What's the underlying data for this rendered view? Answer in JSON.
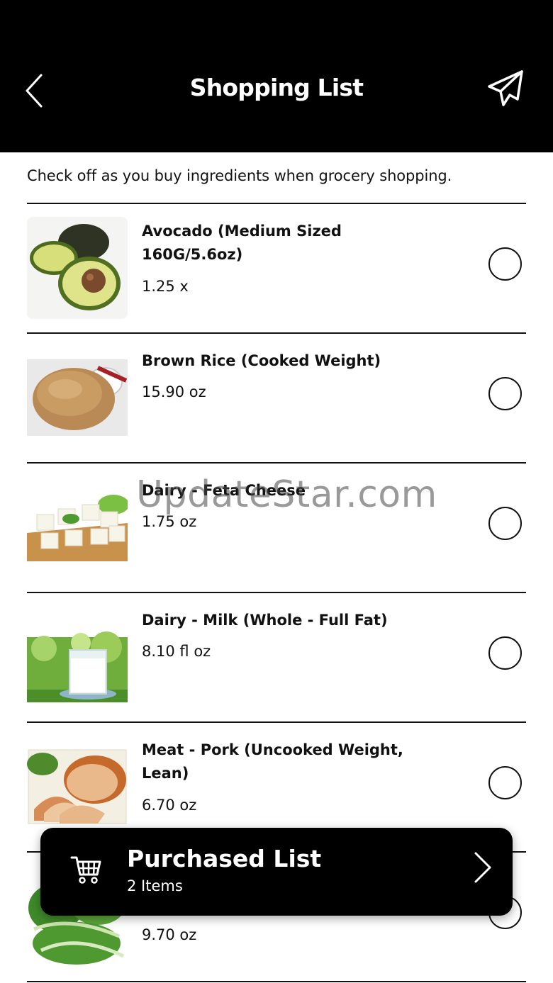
{
  "header": {
    "title": "Shopping List",
    "back_icon": "chevron-left-icon",
    "send_icon": "paper-plane-icon"
  },
  "subtitle": "Check off as you buy ingredients when grocery shopping.",
  "items": [
    {
      "name": "Avocado (Medium Sized 160G/5.6oz)",
      "qty": "1.25 x",
      "checked": false,
      "image": "avocado"
    },
    {
      "name": "Brown Rice (Cooked Weight)",
      "qty": "15.90 oz",
      "checked": false,
      "image": "brown-rice"
    },
    {
      "name": "Dairy - Feta Cheese",
      "qty": "1.75 oz",
      "checked": false,
      "image": "feta-cheese"
    },
    {
      "name": "Dairy - Milk (Whole - Full Fat)",
      "qty": "8.10 fl oz",
      "checked": false,
      "image": "milk-glass"
    },
    {
      "name": "Meat - Pork (Uncooked Weight, Lean)",
      "qty": "6.70 oz",
      "checked": false,
      "image": "roast-pork"
    },
    {
      "name": "",
      "qty": "9.70 oz",
      "checked": false,
      "image": "green-vegetables"
    }
  ],
  "watermark": "UpdateStar.com",
  "purchased": {
    "title": "Purchased List",
    "count": "2 Items",
    "cart_icon": "shopping-cart-icon",
    "chevron_icon": "chevron-right-icon"
  }
}
